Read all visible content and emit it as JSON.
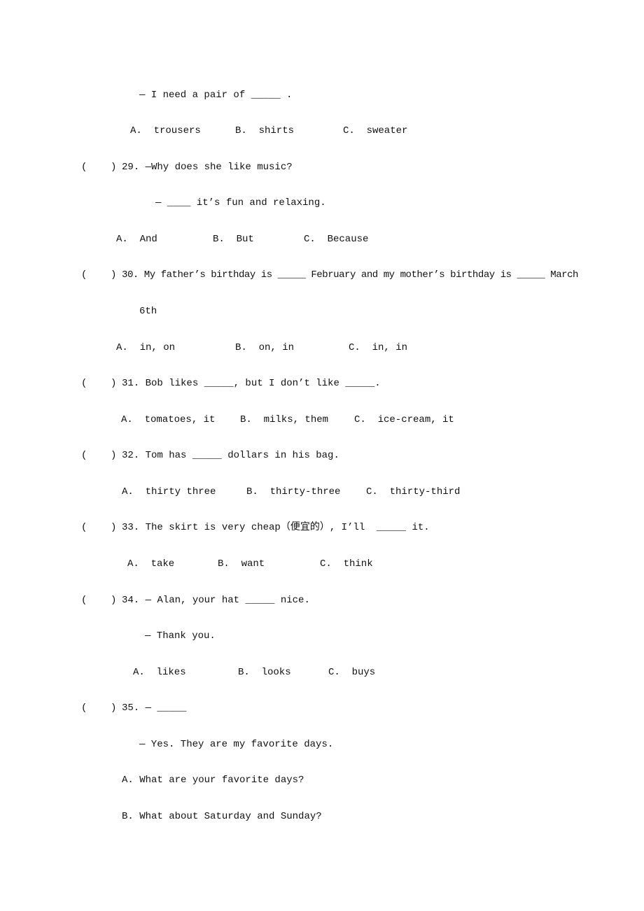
{
  "q28": {
    "stem2": "— I need a pair of _____ .",
    "a": "A.  trousers",
    "b": "B.  shirts",
    "c": "C.  sweater"
  },
  "q29": {
    "paren": "(    )",
    "stem": "29. —Why does she like music?",
    "stem2": "— ____ it’s fun and relaxing.",
    "a": "A.  And",
    "b": "B.  But",
    "c": "C.  Because"
  },
  "q30": {
    "paren": "(    )",
    "stem": "30. My father’s birthday is _____ February and my mother’s birthday is _____ March",
    "stem_cont": "6th",
    "a": "A.  in, on",
    "b": "B.  on, in",
    "c": "C.  in, in"
  },
  "q31": {
    "paren": "(    )",
    "stem": "31. Bob likes _____, but I don’t like _____.",
    "a": "A.  tomatoes, it",
    "b": "B.  milks, them",
    "c": "C.  ice-cream, it"
  },
  "q32": {
    "paren": "(    )",
    "stem": "32. Tom has _____ dollars in his bag.",
    "a": "A.  thirty three",
    "b": "B.  thirty-three",
    "c": "C.  thirty-third"
  },
  "q33": {
    "paren": "(    )",
    "stem": "33. The skirt is very cheap（便宜的）, I’ll  _____ it.",
    "a": "A.  take",
    "b": "B.  want",
    "c": "C.  think"
  },
  "q34": {
    "paren": "(    )",
    "stem": "34. — Alan, your hat _____ nice.",
    "stem2": "— Thank you.",
    "a": "A.  likes",
    "b": "B.  looks",
    "c": "C.  buys"
  },
  "q35": {
    "paren": "(    )",
    "stem": "35. — _____",
    "stem2": "— Yes. They are my favorite days.",
    "a": "A. What are your favorite days?",
    "b": "B. What about Saturday and Sunday?"
  }
}
